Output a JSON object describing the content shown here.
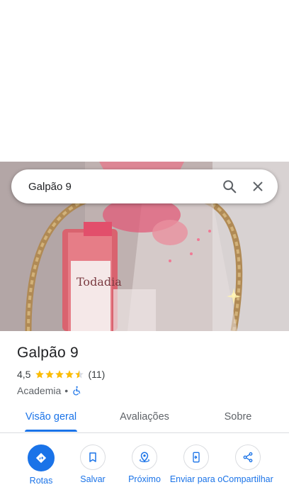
{
  "search": {
    "query": "Galpão 9"
  },
  "place": {
    "name": "Galpão 9",
    "rating": "4,5",
    "reviews": "(11)",
    "stars_filled": 4.5,
    "category": "Academia",
    "separator": "•"
  },
  "photo": {
    "product_text": "Todadia"
  },
  "tabs": [
    {
      "label": "Visão geral",
      "active": true
    },
    {
      "label": "Avaliações",
      "active": false
    },
    {
      "label": "Sobre",
      "active": false
    }
  ],
  "actions": [
    {
      "label": "Rotas",
      "icon": "directions-icon"
    },
    {
      "label": "Salvar",
      "icon": "bookmark-icon"
    },
    {
      "label": "Próximo",
      "icon": "nearby-icon"
    },
    {
      "label": "Enviar para o",
      "icon": "send-to-phone-icon"
    },
    {
      "label": "Compartilhar",
      "icon": "share-icon"
    }
  ],
  "colors": {
    "accent": "#1a73e8",
    "star": "#fbbc04",
    "text": "#202124",
    "muted": "#5f6368"
  }
}
